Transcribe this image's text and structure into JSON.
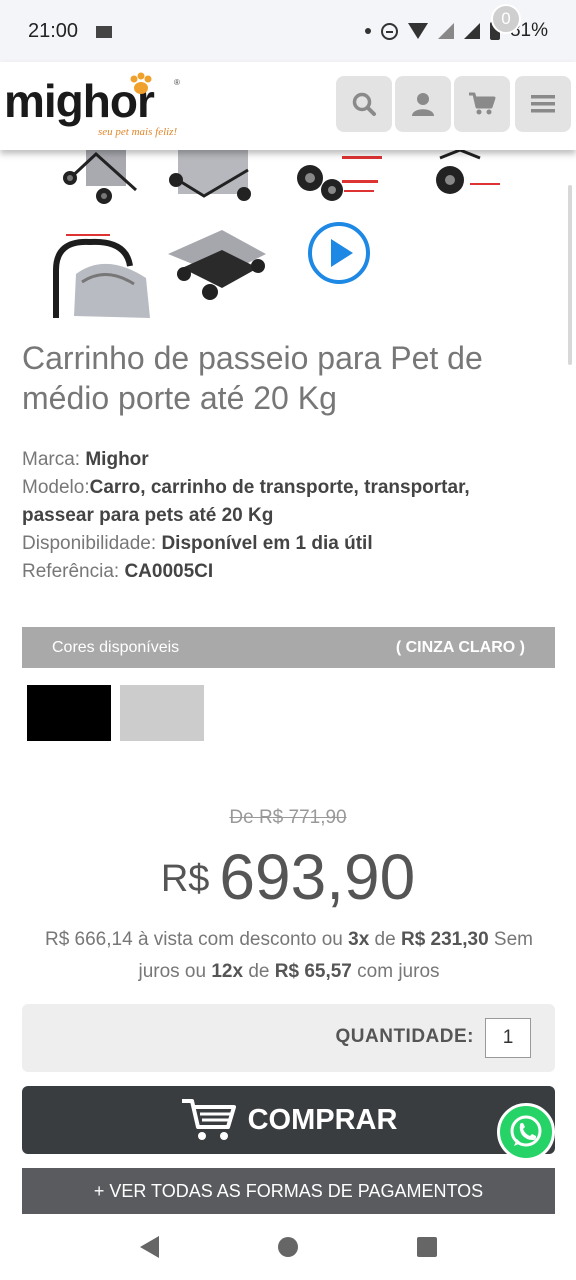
{
  "status_bar": {
    "time": "21:00",
    "battery": "81%",
    "network": "3G"
  },
  "header": {
    "logo_text": "mighor",
    "logo_tagline": "seu pet mais feliz!",
    "cart_count": "0",
    "icons": [
      "search-icon",
      "user-icon",
      "cart-icon",
      "menu-icon"
    ]
  },
  "product": {
    "title": "Carrinho de passeio para Pet de médio porte até 20 Kg",
    "specs": {
      "brand_label": "Marca:",
      "brand_value": "Mighor",
      "model_label": "Modelo:",
      "model_value": "Carro, carrinho de transporte, transportar, passear para pets até 20 Kg",
      "availability_label": "Disponibilidade:",
      "availability_value": "Disponível em 1 dia útil",
      "reference_label": "Referência:",
      "reference_value": "CA0005CI"
    },
    "colors": {
      "label": "Cores disponíveis",
      "selected": "( CINZA CLARO )",
      "swatches": [
        "#000000",
        "#cccccc"
      ]
    }
  },
  "pricing": {
    "old_price": "De R$ 771,90",
    "currency": "R$",
    "price": "693,90",
    "cash_price": "R$ 666,14",
    "text_avista": " à vista com desconto ou ",
    "installments_3": "3x",
    "text_de1": " de ",
    "installment_3_value": "R$ 231,30",
    "text_sem_juros": " Sem juros ou ",
    "installments_12": "12x",
    "text_de2": " de ",
    "installment_12_value": "R$ 65,57",
    "text_com_juros": " com juros"
  },
  "purchase": {
    "quantity_label": "QUANTIDADE:",
    "quantity_value": "1",
    "buy_label": "COMPRAR",
    "payments_label": "+ VER TODAS AS FORMAS DE PAGAMENTOS"
  }
}
